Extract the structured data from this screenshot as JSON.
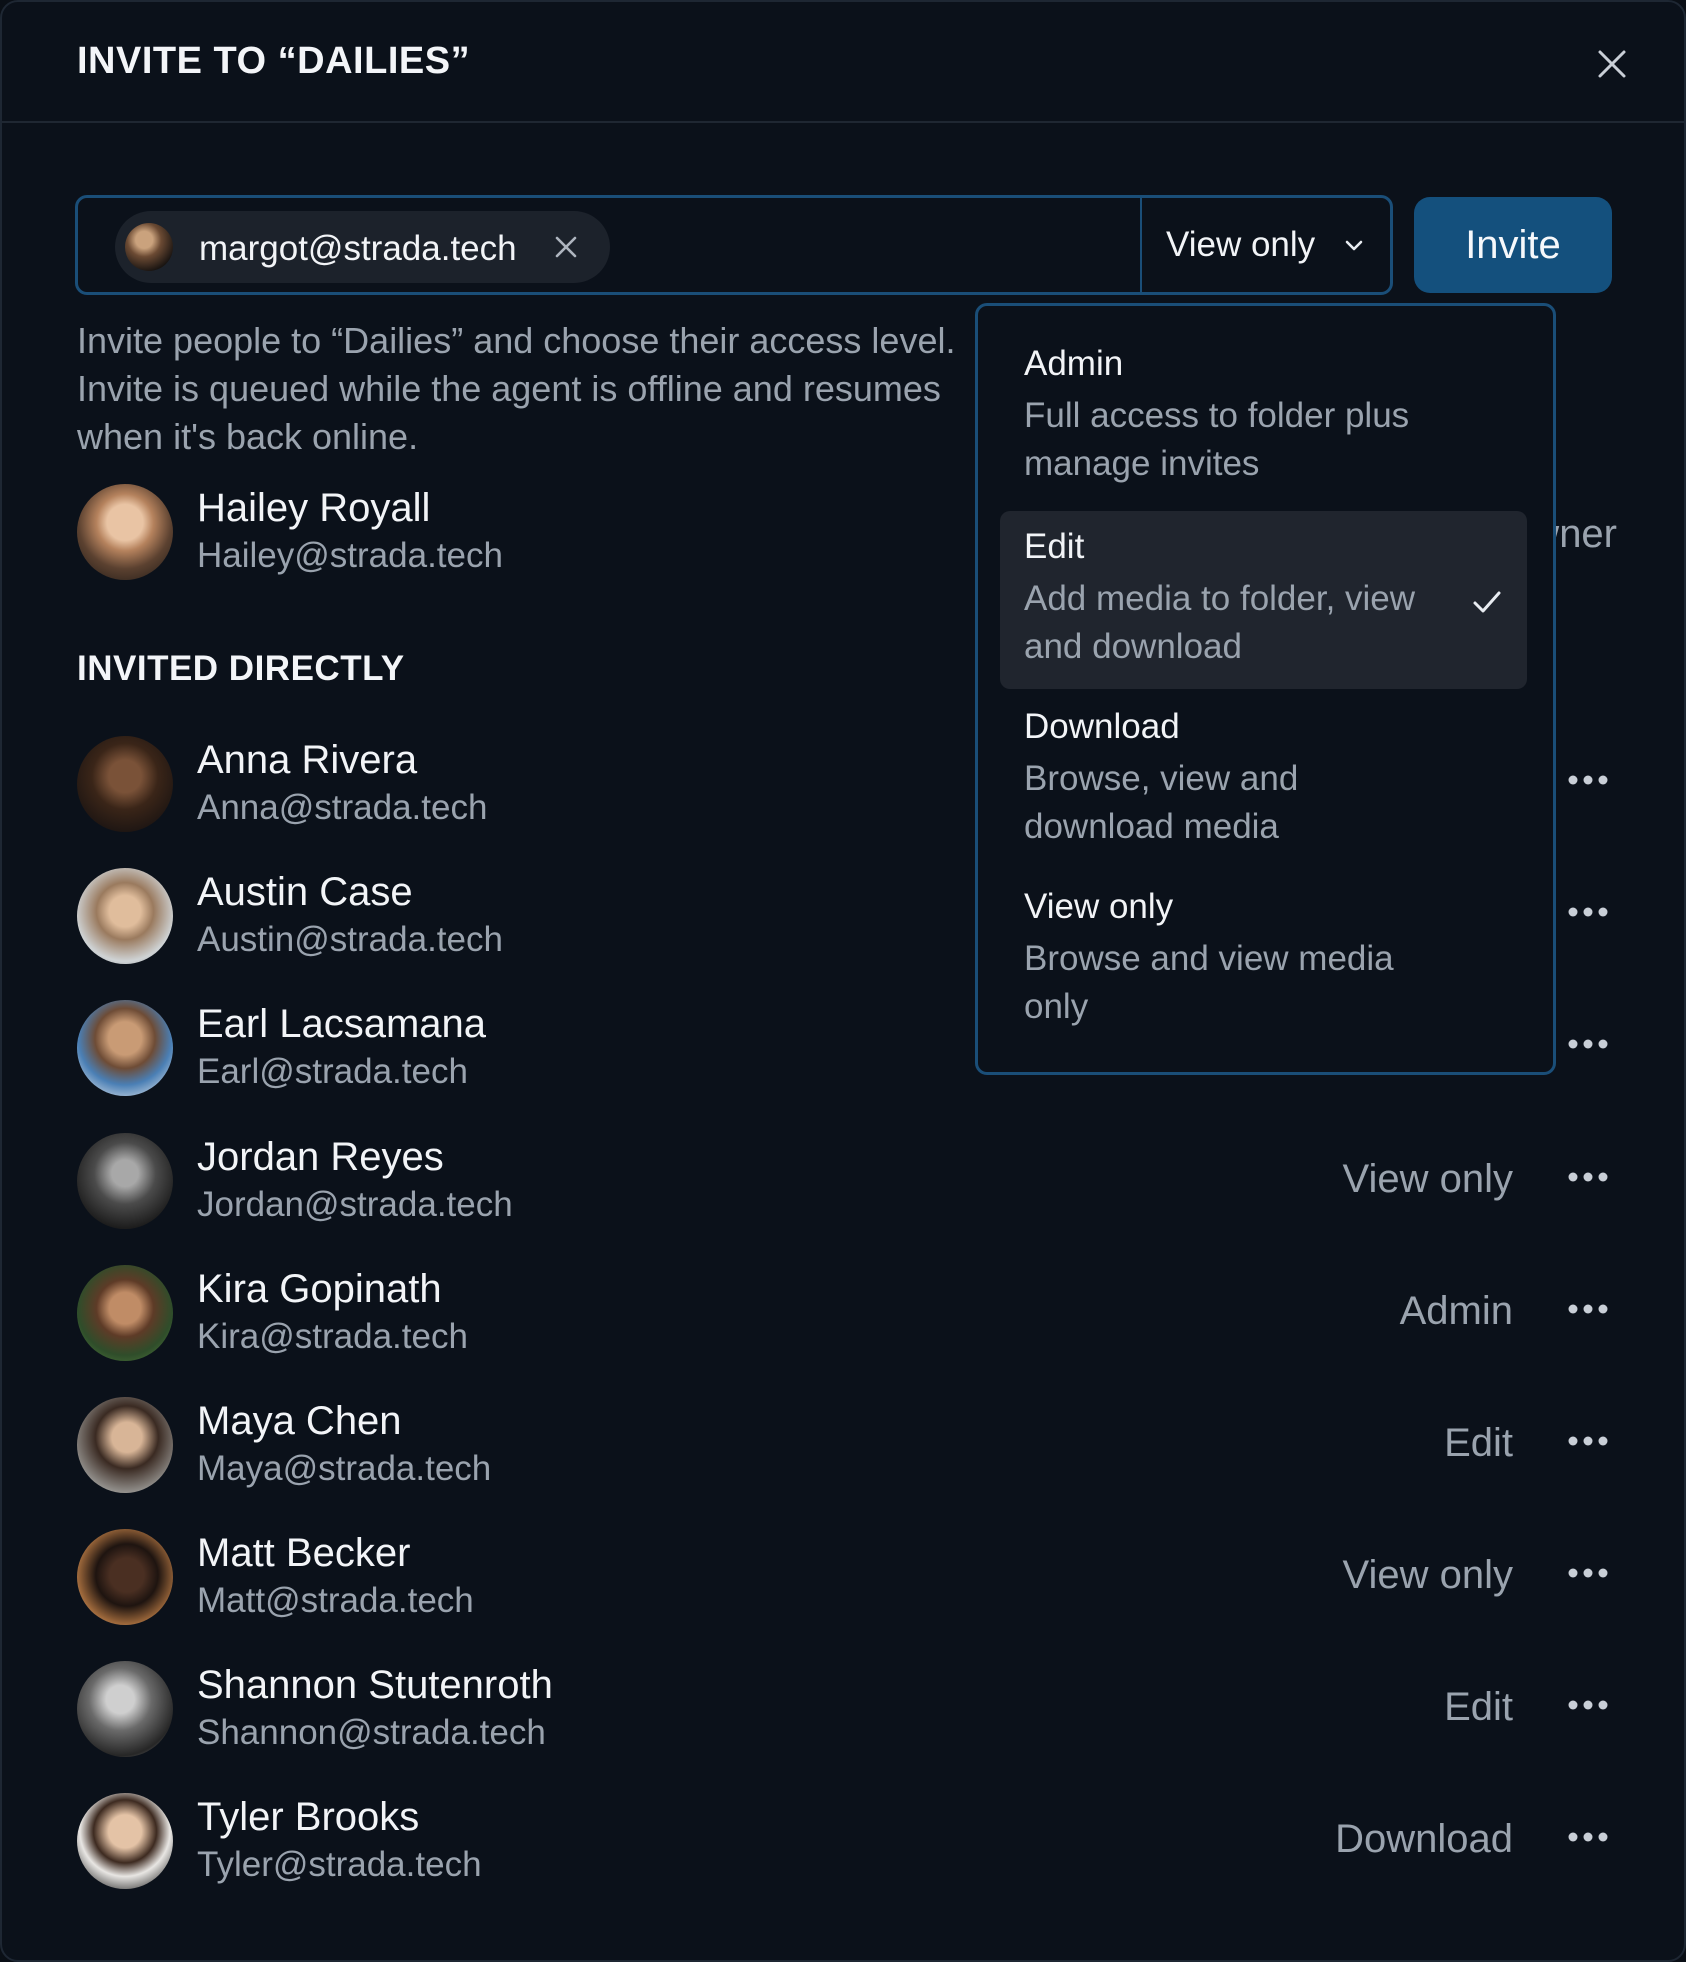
{
  "dialog": {
    "title": "INVITE TO “DAILIES”",
    "close_icon": "close-icon"
  },
  "invite": {
    "chip_email": "margot@strada.tech",
    "role_selected": "View only",
    "button_label": "Invite"
  },
  "description": "Invite people to “Dailies” and choose their access level. Invite is queued while the agent is offline and resumes when it's back online.",
  "owner": {
    "name": "Hailey Royall",
    "email": "Hailey@strada.tech",
    "role": "Owner"
  },
  "section_label": "INVITED DIRECTLY",
  "members": [
    {
      "name": "Anna Rivera",
      "email": "Anna@strada.tech",
      "role": ""
    },
    {
      "name": "Austin Case",
      "email": "Austin@strada.tech",
      "role": ""
    },
    {
      "name": "Earl Lacsamana",
      "email": "Earl@strada.tech",
      "role": ""
    },
    {
      "name": "Jordan Reyes",
      "email": "Jordan@strada.tech",
      "role": "View only"
    },
    {
      "name": "Kira Gopinath",
      "email": "Kira@strada.tech",
      "role": "Admin"
    },
    {
      "name": "Maya Chen",
      "email": "Maya@strada.tech",
      "role": "Edit"
    },
    {
      "name": "Matt Becker",
      "email": "Matt@strada.tech",
      "role": "View only"
    },
    {
      "name": "Shannon Stutenroth",
      "email": "Shannon@strada.tech",
      "role": "Edit"
    },
    {
      "name": "Tyler Brooks",
      "email": "Tyler@strada.tech",
      "role": "Download"
    }
  ],
  "dropdown": {
    "options": [
      {
        "title": "Admin",
        "desc": "Full access to folder plus manage invites",
        "selected": false
      },
      {
        "title": "Edit",
        "desc": "Add media to folder, view and download",
        "selected": true
      },
      {
        "title": "Download",
        "desc": "Browse, view and download media",
        "selected": false
      },
      {
        "title": "View only",
        "desc": "Browse and view media only",
        "selected": false
      }
    ]
  },
  "colors": {
    "background": "#0b111a",
    "accent": "#14507d",
    "border_accent": "#1a4e78",
    "text_primary": "#f2f4f7",
    "text_secondary": "#9aa3ae",
    "selected_option": "#20252e"
  }
}
